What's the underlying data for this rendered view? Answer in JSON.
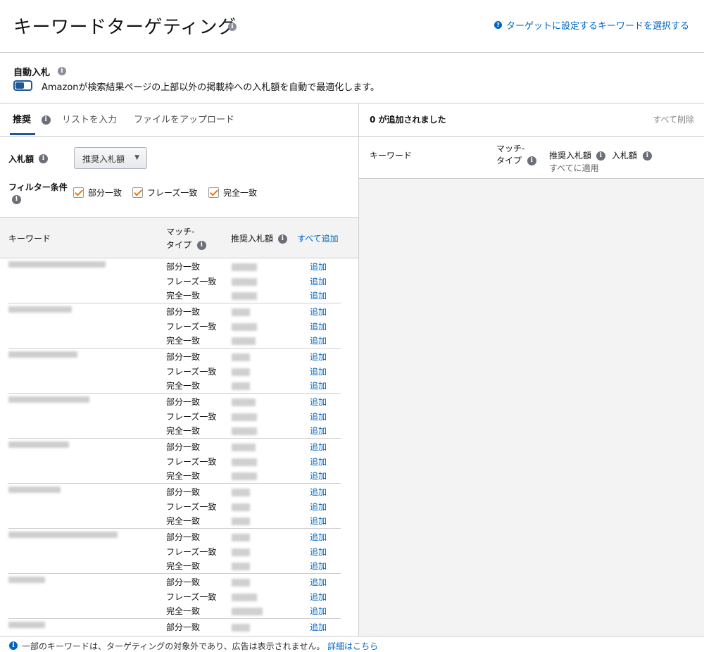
{
  "header": {
    "title": "キーワードターゲティング",
    "link_label": "ターゲットに設定するキーワードを選択する"
  },
  "auto_bid": {
    "title": "自動入札",
    "toggle_on": true,
    "description": "Amazonが検索結果ページの上部以外の掲載枠への入札額を自動で最適化します。"
  },
  "tabs": [
    {
      "label": "推奨",
      "active": true
    },
    {
      "label": "リストを入力",
      "active": false
    },
    {
      "label": "ファイルをアップロード",
      "active": false
    }
  ],
  "bid": {
    "label": "入札額",
    "selected": "推奨入札額"
  },
  "filter": {
    "label": "フィルター条件",
    "options": [
      {
        "label": "部分一致",
        "checked": true
      },
      {
        "label": "フレーズ一致",
        "checked": true
      },
      {
        "label": "完全一致",
        "checked": true
      }
    ]
  },
  "table": {
    "col_keyword": "キーワード",
    "col_match_1": "マッチ-",
    "col_match_2": "タイプ",
    "col_suggested": "推奨入札額",
    "add_all": "すべて追加",
    "add_label": "追加",
    "groups": [
      {
        "matches": [
          "部分一致",
          "フレーズ一致",
          "完全一致"
        ]
      },
      {
        "matches": [
          "部分一致",
          "フレーズ一致",
          "完全一致"
        ]
      },
      {
        "matches": [
          "部分一致",
          "フレーズ一致",
          "完全一致"
        ]
      },
      {
        "matches": [
          "部分一致",
          "フレーズ一致",
          "完全一致"
        ]
      },
      {
        "matches": [
          "部分一致",
          "フレーズ一致",
          "完全一致"
        ]
      },
      {
        "matches": [
          "部分一致",
          "フレーズ一致",
          "完全一致"
        ]
      },
      {
        "matches": [
          "部分一致",
          "フレーズ一致",
          "完全一致"
        ]
      },
      {
        "matches": [
          "部分一致",
          "フレーズ一致",
          "完全一致"
        ]
      },
      {
        "matches": [
          "部分一致"
        ]
      }
    ]
  },
  "added_panel": {
    "count_label": "0 が追加されました",
    "delete_all": "すべて削除",
    "col_keyword": "キーワード",
    "col_match_1": "マッチ-",
    "col_match_2": "タイプ",
    "col_suggested": "推奨入札額",
    "apply_all": "すべてに適用",
    "col_bid": "入札額"
  },
  "footer": {
    "text": "一部のキーワードは、ターゲティングの対象外であり、広告は表示されません。",
    "link": "詳細はこちら"
  }
}
